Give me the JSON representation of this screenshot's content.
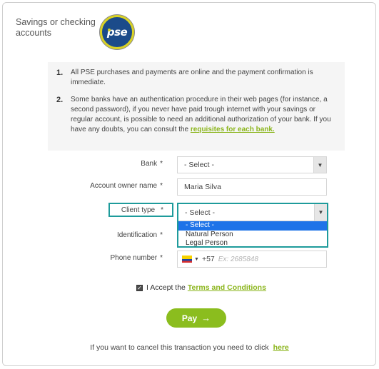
{
  "header": {
    "title": "Savings or checking accounts",
    "logo_text": "pse"
  },
  "info": {
    "items": [
      {
        "num": "1.",
        "text": "All PSE purchases and payments are online and the payment confirmation is immediate."
      },
      {
        "num": "2.",
        "text": "Some banks have an authentication procedure in their web pages (for instance, a second password), if you never have paid trough internet with your savings or regular account, is possible to need an additional authorization of your bank. If you have any doubts, you can consult the ",
        "link": "requisites for each bank."
      }
    ]
  },
  "form": {
    "bank": {
      "label": "Bank",
      "required": "*",
      "value": "- Select -"
    },
    "owner": {
      "label": "Account owner name",
      "required": "*",
      "value": "Maria Silva"
    },
    "client_type": {
      "label": "Client type",
      "required": "*",
      "value": "- Select -",
      "options": [
        "- Select -",
        "Natural Person",
        "Legal Person"
      ]
    },
    "identification": {
      "label": "Identification",
      "required": "*"
    },
    "phone": {
      "label": "Phone number",
      "required": "*",
      "code": "+57",
      "placeholder": "Ex: 2685848",
      "flag": "colombia-flag"
    },
    "accept": {
      "prefix": "I Accept the",
      "link": "Terms and Conditions",
      "checked": true
    }
  },
  "pay": {
    "label": "Pay",
    "arrow": "→"
  },
  "cancel": {
    "text": "If you want to cancel this transaction you need to click",
    "link": "here"
  },
  "colors": {
    "accent": "#8bbd1e",
    "focus": "#1e9b9b",
    "selected_option": "#1e73e8"
  }
}
